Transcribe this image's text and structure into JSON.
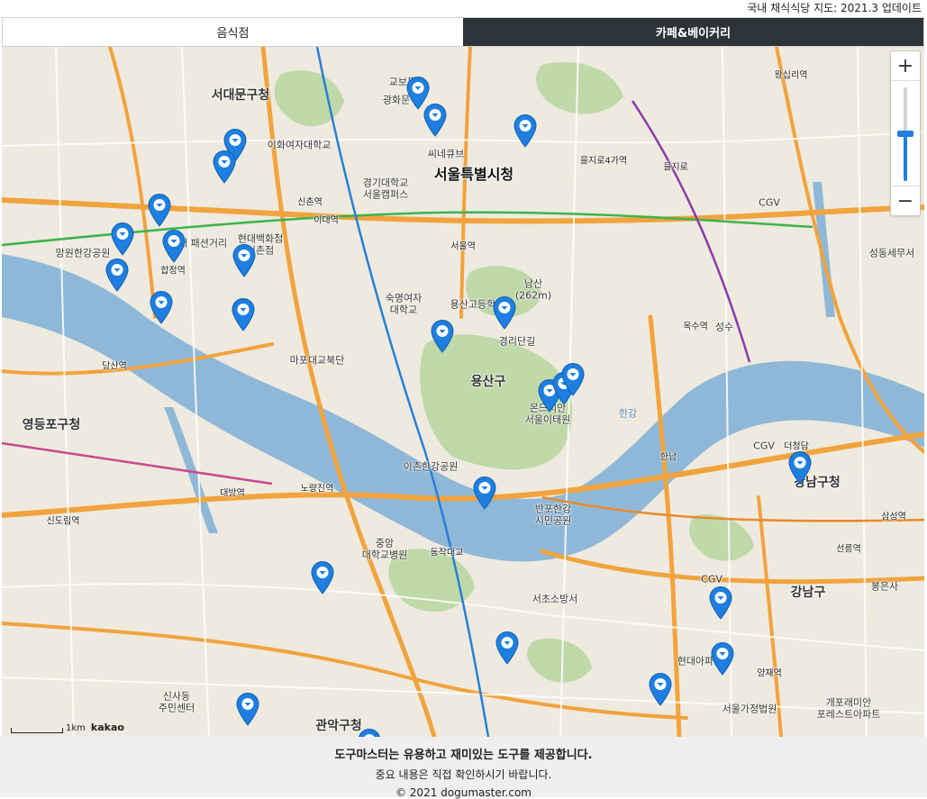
{
  "header": {
    "caption": "국내 채식식당 지도: 2021.3 업데이트"
  },
  "tabs": [
    {
      "label": "음식점",
      "active": false
    },
    {
      "label": "카페&베이커리",
      "active": true
    }
  ],
  "map": {
    "zoom": {
      "in": "+",
      "out": "−",
      "level_fraction": 0.5
    },
    "scale": {
      "label": "1km",
      "brand": "kakao"
    },
    "labels": {
      "city_hall": "서울특별시청",
      "yongsan_gu": "용산구",
      "yeongdeungpo_gu": "영등포구청",
      "gangnam_gu": "강남구청",
      "gangnam": "강남구",
      "seodaemun_gu": "서대문구청",
      "gwanak_gu": "관악구청",
      "namsan": "남산\n(262m)",
      "hangang": "한강",
      "yongsan_high": "용산고등학교",
      "seoul_station": "서울역",
      "euljiro4": "을지로4가역",
      "ichon": "이촌한강공원",
      "banpo": "반포한강\n시민공원",
      "mangwon": "망원한강공원",
      "yeouido_mapo": "마포대교북단",
      "hongdae": "홍대 패션거리",
      "hyundai": "현대백화점\n신촌점",
      "chungang": "중앙\n대학교병원",
      "kyunghee": "경기대학교\n서울캠퍼스",
      "ssibel": "씨네큐브",
      "sungsu": "성수",
      "cgv1": "CGV",
      "cgv2": "CGV",
      "cgv3": "CGV",
      "seongdong": "성동세무서",
      "seocho": "서초소방서",
      "seolleung": "선릉역",
      "yangjae": "양재역",
      "hannam": "한남",
      "itaewon": "몬드리안\n서울이태원",
      "dongjak": "동작대교",
      "noryangjin": "노량진역",
      "daebang": "대방역",
      "sindorim": "신도림역",
      "dangsan": "당산역",
      "oksu": "옥수역",
      "cheongdam": "더청담",
      "wangsimni": "왕십리역",
      "euljiro": "을지로",
      "samseong": "삼성역",
      "hapjeong": "합정역",
      "sinchon": "신촌역",
      "ewha": "이대역",
      "gyeongnidan": "경리단길",
      "gyobo": "교보문고",
      "gwanghwamun": "광화문",
      "bongeunsa": "봉은사",
      "gaepo": "개포래미안\n포레스트아파트",
      "seoul_gajeong": "서울가정법원",
      "ehwa_univ": "이화여자대학교",
      "sookmyung": "숙명여자\n대학교",
      "hyundaiapt": "현대아파트",
      "sinsa": "신사동\n주민센터"
    }
  },
  "footer": {
    "line1": "도구마스터는 유용하고 재미있는 도구를 제공합니다.",
    "line2": "중요 내용은 직접 확인하시기 바랍니다.",
    "line3": "© 2021 dogumaster.com"
  },
  "colors": {
    "active_tab": "#2d3439",
    "marker": "#1e7fe0",
    "river": "#8fb8d8",
    "park": "#b9d7a3",
    "road": "#f1a33d"
  }
}
